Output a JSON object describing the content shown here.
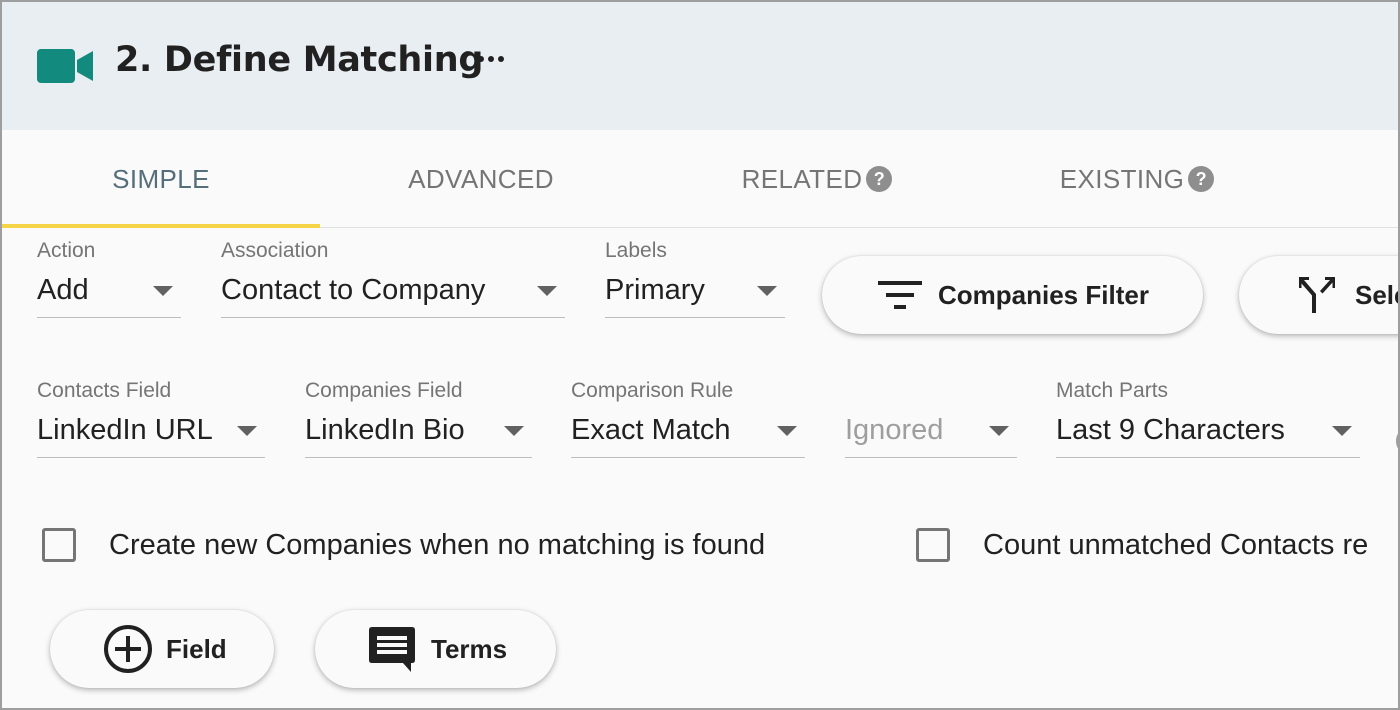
{
  "header": {
    "title": "2. Define Matching",
    "icon": "video-camera-icon",
    "accent": "#138a7e"
  },
  "tabs": [
    {
      "label": "SIMPLE",
      "active": true
    },
    {
      "label": "ADVANCED",
      "active": false
    },
    {
      "label": "RELATED",
      "active": false,
      "help": "?"
    },
    {
      "label": "EXISTING",
      "active": false,
      "help": "?"
    }
  ],
  "row1": {
    "action": {
      "label": "Action",
      "value": "Add"
    },
    "association": {
      "label": "Association",
      "value": "Contact to Company"
    },
    "labels": {
      "label": "Labels",
      "value": "Primary"
    },
    "companies_filter": "Companies Filter",
    "select_button": "Sele"
  },
  "row2": {
    "contacts_field": {
      "label": "Contacts Field",
      "value": "LinkedIn URL"
    },
    "companies_field": {
      "label": "Companies Field",
      "value": "LinkedIn Bio"
    },
    "comparison_rule": {
      "label": "Comparison Rule",
      "value": "Exact Match"
    },
    "ignored": {
      "value": "Ignored"
    },
    "match_parts": {
      "label": "Match Parts",
      "value": "Last 9 Characters"
    }
  },
  "checkboxes": {
    "create_new": "Create new Companies when no matching is found",
    "count_unmatched": "Count unmatched Contacts re"
  },
  "actions": {
    "field": "Field",
    "terms": "Terms"
  }
}
